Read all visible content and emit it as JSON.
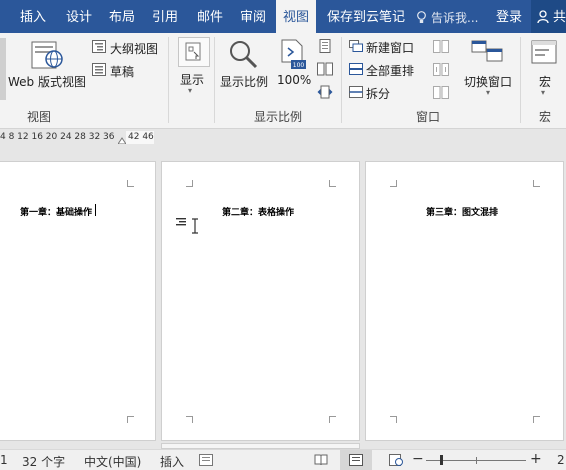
{
  "tabs": [
    {
      "label": "插入"
    },
    {
      "label": "设计"
    },
    {
      "label": "布局"
    },
    {
      "label": "引用"
    },
    {
      "label": "邮件"
    },
    {
      "label": "审阅"
    },
    {
      "label": "视图"
    },
    {
      "label": "保存到云笔记"
    }
  ],
  "tell_me": "告诉我...",
  "login": "登录",
  "share": "共",
  "ribbon": {
    "views": {
      "web_layout": "Web 版式视图",
      "outline": "大纲视图",
      "draft": "草稿",
      "group_label": "视图"
    },
    "show": {
      "label": "显示"
    },
    "zoom": {
      "zoom_label": "显示比例",
      "percent_label": "100%",
      "group_label": "显示比例",
      "icon_text": "100"
    },
    "window": {
      "new_window": "新建窗口",
      "arrange_all": "全部重排",
      "split": "拆分",
      "switch_windows": "切换窗口",
      "group_label": "窗口"
    },
    "macros": {
      "label": "宏",
      "group_label": "宏"
    }
  },
  "ruler": {
    "numbers": "4  8  12 16 20 24 28 32 36",
    "highlight": "42 46"
  },
  "pages": [
    {
      "title": "第一章：基础操作"
    },
    {
      "title": "第二章：表格操作"
    },
    {
      "title": "第三章：图文混排"
    }
  ],
  "status": {
    "page": "1",
    "word_count": "32 个字",
    "language": "中文(中国)",
    "mode": "插入",
    "zoom_right": "2"
  },
  "colors": {
    "accent": "#2b579a",
    "ribbon_bg": "#f3f3f3",
    "canvas_bg": "#e6e6e6"
  }
}
